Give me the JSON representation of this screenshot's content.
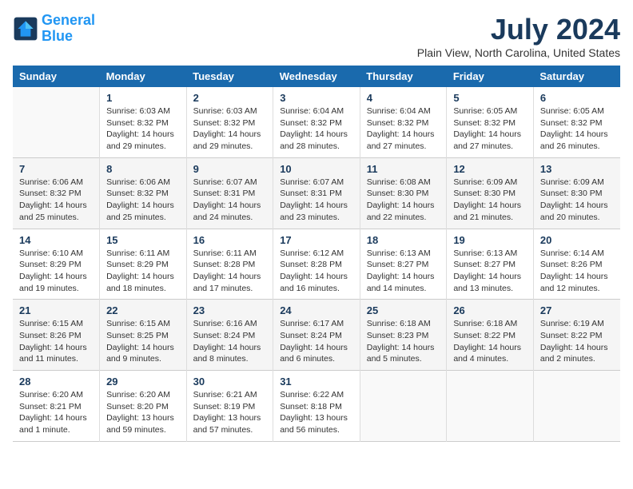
{
  "header": {
    "logo_line1": "General",
    "logo_line2": "Blue",
    "title": "July 2024",
    "subtitle": "Plain View, North Carolina, United States"
  },
  "weekdays": [
    "Sunday",
    "Monday",
    "Tuesday",
    "Wednesday",
    "Thursday",
    "Friday",
    "Saturday"
  ],
  "weeks": [
    [
      {
        "num": "",
        "info": ""
      },
      {
        "num": "1",
        "info": "Sunrise: 6:03 AM\nSunset: 8:32 PM\nDaylight: 14 hours\nand 29 minutes."
      },
      {
        "num": "2",
        "info": "Sunrise: 6:03 AM\nSunset: 8:32 PM\nDaylight: 14 hours\nand 29 minutes."
      },
      {
        "num": "3",
        "info": "Sunrise: 6:04 AM\nSunset: 8:32 PM\nDaylight: 14 hours\nand 28 minutes."
      },
      {
        "num": "4",
        "info": "Sunrise: 6:04 AM\nSunset: 8:32 PM\nDaylight: 14 hours\nand 27 minutes."
      },
      {
        "num": "5",
        "info": "Sunrise: 6:05 AM\nSunset: 8:32 PM\nDaylight: 14 hours\nand 27 minutes."
      },
      {
        "num": "6",
        "info": "Sunrise: 6:05 AM\nSunset: 8:32 PM\nDaylight: 14 hours\nand 26 minutes."
      }
    ],
    [
      {
        "num": "7",
        "info": "Sunrise: 6:06 AM\nSunset: 8:32 PM\nDaylight: 14 hours\nand 25 minutes."
      },
      {
        "num": "8",
        "info": "Sunrise: 6:06 AM\nSunset: 8:32 PM\nDaylight: 14 hours\nand 25 minutes."
      },
      {
        "num": "9",
        "info": "Sunrise: 6:07 AM\nSunset: 8:31 PM\nDaylight: 14 hours\nand 24 minutes."
      },
      {
        "num": "10",
        "info": "Sunrise: 6:07 AM\nSunset: 8:31 PM\nDaylight: 14 hours\nand 23 minutes."
      },
      {
        "num": "11",
        "info": "Sunrise: 6:08 AM\nSunset: 8:30 PM\nDaylight: 14 hours\nand 22 minutes."
      },
      {
        "num": "12",
        "info": "Sunrise: 6:09 AM\nSunset: 8:30 PM\nDaylight: 14 hours\nand 21 minutes."
      },
      {
        "num": "13",
        "info": "Sunrise: 6:09 AM\nSunset: 8:30 PM\nDaylight: 14 hours\nand 20 minutes."
      }
    ],
    [
      {
        "num": "14",
        "info": "Sunrise: 6:10 AM\nSunset: 8:29 PM\nDaylight: 14 hours\nand 19 minutes."
      },
      {
        "num": "15",
        "info": "Sunrise: 6:11 AM\nSunset: 8:29 PM\nDaylight: 14 hours\nand 18 minutes."
      },
      {
        "num": "16",
        "info": "Sunrise: 6:11 AM\nSunset: 8:28 PM\nDaylight: 14 hours\nand 17 minutes."
      },
      {
        "num": "17",
        "info": "Sunrise: 6:12 AM\nSunset: 8:28 PM\nDaylight: 14 hours\nand 16 minutes."
      },
      {
        "num": "18",
        "info": "Sunrise: 6:13 AM\nSunset: 8:27 PM\nDaylight: 14 hours\nand 14 minutes."
      },
      {
        "num": "19",
        "info": "Sunrise: 6:13 AM\nSunset: 8:27 PM\nDaylight: 14 hours\nand 13 minutes."
      },
      {
        "num": "20",
        "info": "Sunrise: 6:14 AM\nSunset: 8:26 PM\nDaylight: 14 hours\nand 12 minutes."
      }
    ],
    [
      {
        "num": "21",
        "info": "Sunrise: 6:15 AM\nSunset: 8:26 PM\nDaylight: 14 hours\nand 11 minutes."
      },
      {
        "num": "22",
        "info": "Sunrise: 6:15 AM\nSunset: 8:25 PM\nDaylight: 14 hours\nand 9 minutes."
      },
      {
        "num": "23",
        "info": "Sunrise: 6:16 AM\nSunset: 8:24 PM\nDaylight: 14 hours\nand 8 minutes."
      },
      {
        "num": "24",
        "info": "Sunrise: 6:17 AM\nSunset: 8:24 PM\nDaylight: 14 hours\nand 6 minutes."
      },
      {
        "num": "25",
        "info": "Sunrise: 6:18 AM\nSunset: 8:23 PM\nDaylight: 14 hours\nand 5 minutes."
      },
      {
        "num": "26",
        "info": "Sunrise: 6:18 AM\nSunset: 8:22 PM\nDaylight: 14 hours\nand 4 minutes."
      },
      {
        "num": "27",
        "info": "Sunrise: 6:19 AM\nSunset: 8:22 PM\nDaylight: 14 hours\nand 2 minutes."
      }
    ],
    [
      {
        "num": "28",
        "info": "Sunrise: 6:20 AM\nSunset: 8:21 PM\nDaylight: 14 hours\nand 1 minute."
      },
      {
        "num": "29",
        "info": "Sunrise: 6:20 AM\nSunset: 8:20 PM\nDaylight: 13 hours\nand 59 minutes."
      },
      {
        "num": "30",
        "info": "Sunrise: 6:21 AM\nSunset: 8:19 PM\nDaylight: 13 hours\nand 57 minutes."
      },
      {
        "num": "31",
        "info": "Sunrise: 6:22 AM\nSunset: 8:18 PM\nDaylight: 13 hours\nand 56 minutes."
      },
      {
        "num": "",
        "info": ""
      },
      {
        "num": "",
        "info": ""
      },
      {
        "num": "",
        "info": ""
      }
    ]
  ]
}
